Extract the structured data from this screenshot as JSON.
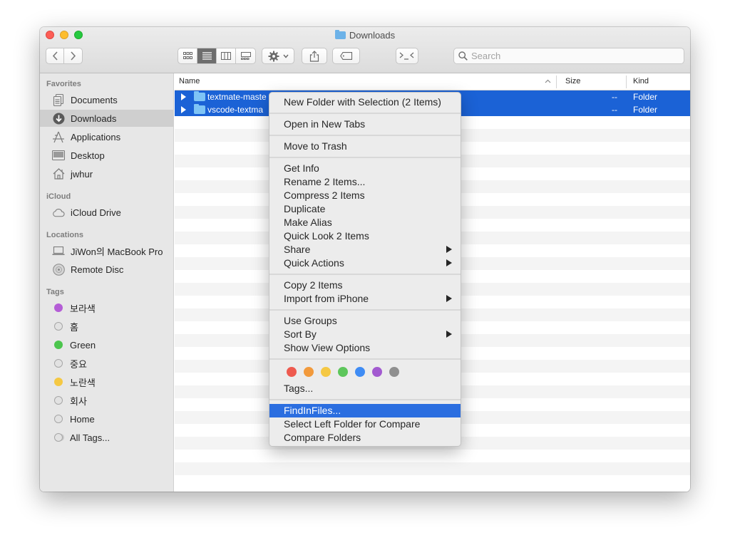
{
  "window": {
    "title": "Downloads"
  },
  "toolbar": {
    "back_icon": "chevron-left-icon",
    "forward_icon": "chevron-right-icon",
    "view_modes": [
      "icon-view",
      "list-view",
      "column-view",
      "gallery-view"
    ],
    "active_view": "list-view",
    "search_placeholder": "Search"
  },
  "sidebar": {
    "favorites_label": "Favorites",
    "favorites": [
      {
        "label": "Documents",
        "icon": "documents-icon"
      },
      {
        "label": "Downloads",
        "icon": "downloads-icon",
        "selected": true
      },
      {
        "label": "Applications",
        "icon": "applications-icon"
      },
      {
        "label": "Desktop",
        "icon": "desktop-icon"
      },
      {
        "label": "jwhur",
        "icon": "home-icon"
      }
    ],
    "icloud_label": "iCloud",
    "icloud": [
      {
        "label": "iCloud Drive",
        "icon": "cloud-icon"
      }
    ],
    "locations_label": "Locations",
    "locations": [
      {
        "label": "JiWon의 MacBook Pro",
        "icon": "laptop-icon"
      },
      {
        "label": "Remote Disc",
        "icon": "disc-icon"
      }
    ],
    "tags_label": "Tags",
    "tags": [
      {
        "label": "보라색",
        "color": "#b45dd6"
      },
      {
        "label": "홈",
        "color": ""
      },
      {
        "label": "Green",
        "color": "#4cc54d"
      },
      {
        "label": "중요",
        "color": ""
      },
      {
        "label": "노란색",
        "color": "#f5c843"
      },
      {
        "label": "회사",
        "color": ""
      },
      {
        "label": "Home",
        "color": ""
      },
      {
        "label": "All Tags...",
        "color": ""
      }
    ]
  },
  "columns": {
    "name": "Name",
    "size": "Size",
    "kind": "Kind"
  },
  "files": [
    {
      "name": "textmate-maste",
      "size": "--",
      "kind": "Folder"
    },
    {
      "name": "vscode-textma",
      "size": "--",
      "kind": "Folder"
    }
  ],
  "context_menu": {
    "items": {
      "new_folder": "New Folder with Selection (2 Items)",
      "open_tabs": "Open in New Tabs",
      "trash": "Move to Trash",
      "get_info": "Get Info",
      "rename": "Rename 2 Items...",
      "compress": "Compress 2 Items",
      "duplicate": "Duplicate",
      "make_alias": "Make Alias",
      "quick_look": "Quick Look 2 Items",
      "share": "Share",
      "quick_actions": "Quick Actions",
      "copy": "Copy 2 Items",
      "import_iphone": "Import from iPhone",
      "use_groups": "Use Groups",
      "sort_by": "Sort By",
      "view_options": "Show View Options",
      "tags": "Tags...",
      "find_in_files": "FindInFiles...",
      "select_left": "Select Left Folder for Compare",
      "compare": "Compare Folders"
    },
    "tag_colors": [
      "#ee5a4f",
      "#f29a3c",
      "#f5c843",
      "#5dc65b",
      "#3f8cf4",
      "#a25ad0",
      "#8f8f8f"
    ],
    "highlighted": "find_in_files"
  }
}
